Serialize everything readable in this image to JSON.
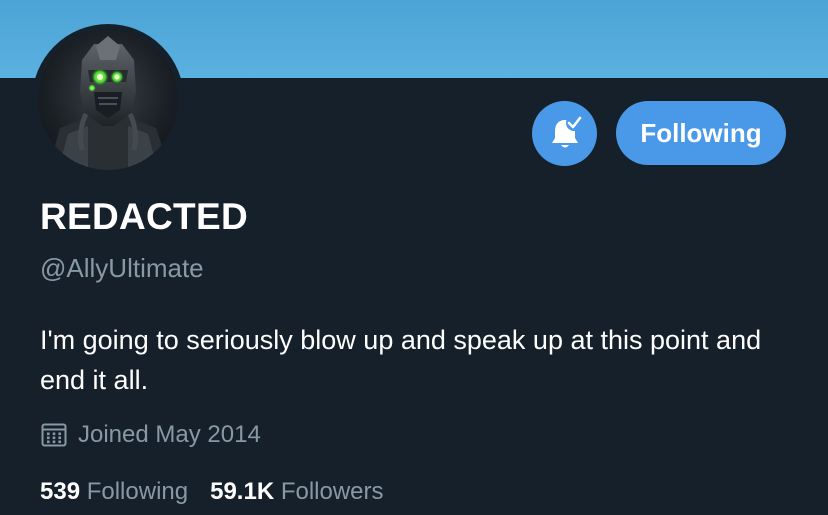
{
  "profile": {
    "display_name": "REDACTED",
    "handle": "@AllyUltimate",
    "bio": "I'm going to seriously blow up and speak up at this point and end it all.",
    "joined": "Joined May 2014",
    "avatar_icon": "armored-robot-avatar"
  },
  "actions": {
    "notifications_icon": "bell-check-icon",
    "follow_label": "Following"
  },
  "stats": {
    "following_count": "539",
    "following_label": "Following",
    "followers_count": "59.1K",
    "followers_label": "Followers"
  },
  "colors": {
    "background": "#15202b",
    "banner": "#5bb2e0",
    "accent": "#4a99e9",
    "secondary_text": "#8899a6"
  }
}
